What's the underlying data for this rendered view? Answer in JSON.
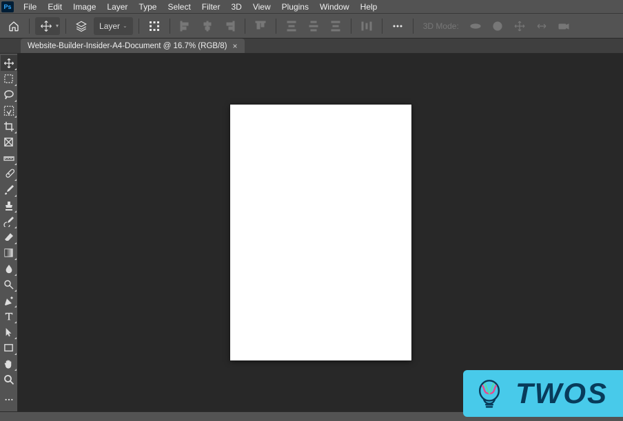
{
  "menubar": {
    "items": [
      "File",
      "Edit",
      "Image",
      "Layer",
      "Type",
      "Select",
      "Filter",
      "3D",
      "View",
      "Plugins",
      "Window",
      "Help"
    ]
  },
  "options": {
    "layer_label": "Layer",
    "threeD_label": "3D Mode:"
  },
  "tab": {
    "title": "Website-Builder-Insider-A4-Document @ 16.7% (RGB/8)"
  },
  "tools": [
    "move-tool",
    "marquee-tool",
    "lasso-tool",
    "object-select-tool",
    "crop-tool",
    "frame-tool",
    "ruler-tool",
    "healing-brush-tool",
    "brush-tool",
    "stamp-tool",
    "history-brush-tool",
    "eraser-tool",
    "gradient-tool",
    "blur-tool",
    "dodge-tool",
    "pen-tool",
    "type-tool",
    "path-select-tool",
    "rectangle-tool",
    "hand-tool",
    "zoom-tool"
  ],
  "canvas": {
    "bg": "#ffffff"
  },
  "badge": {
    "text": "TWOS"
  }
}
